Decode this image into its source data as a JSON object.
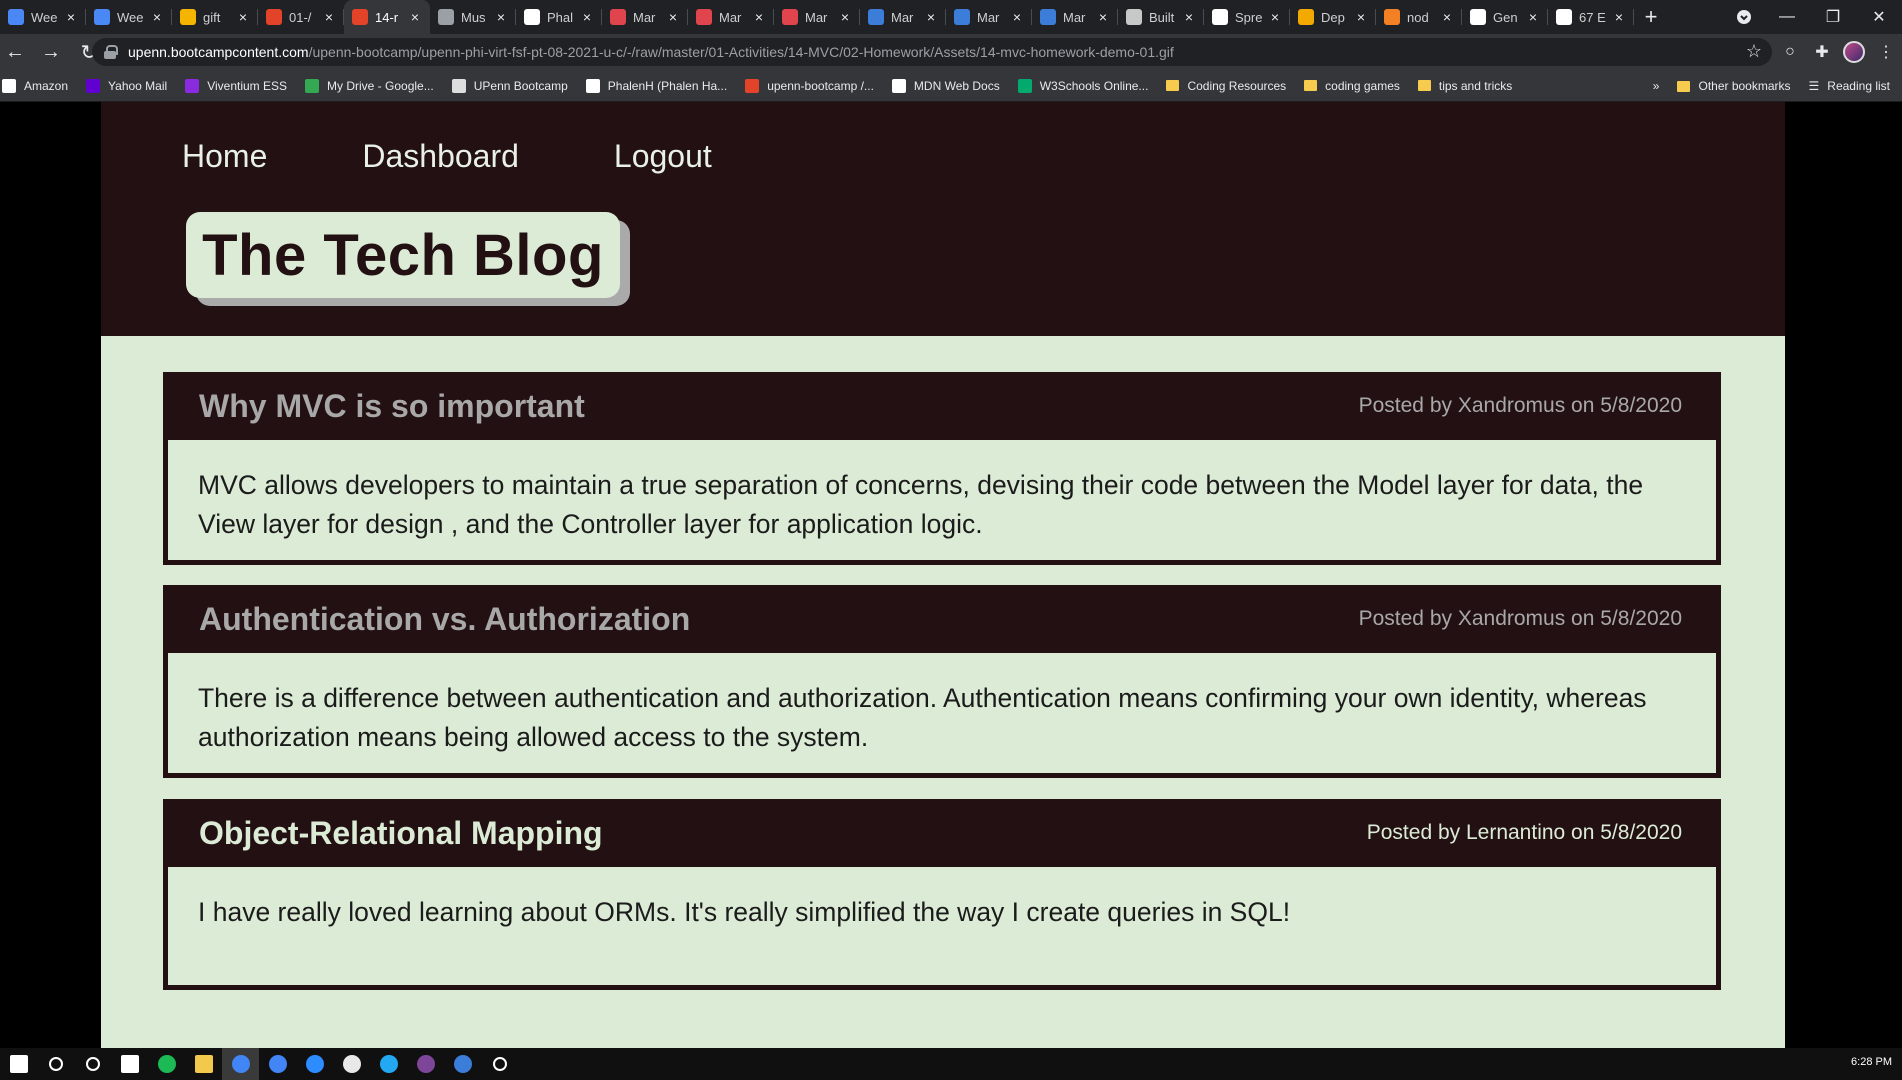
{
  "browser": {
    "tabs": [
      {
        "title": "Wee",
        "favicon_color": "#4a88f5",
        "favicon": "docs-icon"
      },
      {
        "title": "Wee",
        "favicon_color": "#4a88f5",
        "favicon": "docs-icon"
      },
      {
        "title": "gift",
        "favicon_color": "#f4b400",
        "favicon": "slides-icon"
      },
      {
        "title": "01-/",
        "favicon_color": "#e24329",
        "favicon": "gitlab-icon"
      },
      {
        "title": "14-r",
        "favicon_color": "#e24329",
        "favicon": "gitlab-icon",
        "active": true
      },
      {
        "title": "Mus",
        "favicon_color": "#9aa0a6",
        "favicon": "globe-icon"
      },
      {
        "title": "Phal",
        "favicon_color": "#ffffff",
        "favicon": "github-icon"
      },
      {
        "title": "Mar",
        "favicon_color": "#e0444c",
        "favicon": "mongoose-icon"
      },
      {
        "title": "Mar",
        "favicon_color": "#e0444c",
        "favicon": "mongoose-icon"
      },
      {
        "title": "Mar",
        "favicon_color": "#e0444c",
        "favicon": "mongoose-icon"
      },
      {
        "title": "Mar",
        "favicon_color": "#3b7dd8",
        "favicon": "cube-icon"
      },
      {
        "title": "Mar",
        "favicon_color": "#3b7dd8",
        "favicon": "cube-icon"
      },
      {
        "title": "Mar",
        "favicon_color": "#3b7dd8",
        "favicon": "cube-icon"
      },
      {
        "title": "Built",
        "favicon_color": "#c8c8c8",
        "favicon": "link-icon"
      },
      {
        "title": "Spre",
        "favicon_color": "#ffffff",
        "favicon": "bootcamp-icon"
      },
      {
        "title": "Dep",
        "favicon_color": "#f2a900",
        "favicon": "fs-icon"
      },
      {
        "title": "nod",
        "favicon_color": "#f48024",
        "favicon": "stackoverflow-icon"
      },
      {
        "title": "Gen",
        "favicon_color": "#ffffff",
        "favicon": "bootcamp-icon"
      },
      {
        "title": "67 E",
        "favicon_color": "#ffffff",
        "favicon": "f-icon"
      }
    ],
    "new_tab": "+",
    "url_host": "upenn.bootcampcontent.com",
    "url_path": "/upenn-bootcamp/upenn-phi-virt-fsf-pt-08-2021-u-c/-/raw/master/01-Activities/14-MVC/02-Homework/Assets/14-mvc-homework-demo-01.gif",
    "bookmarks": [
      {
        "label": "Amazon",
        "icon": "amazon-icon",
        "color": "#ffffff"
      },
      {
        "label": "Yahoo Mail",
        "icon": "yahoo-mail-icon",
        "color": "#6001d2"
      },
      {
        "label": "Viventium ESS",
        "icon": "viventium-icon",
        "color": "#8a2be2"
      },
      {
        "label": "My Drive - Google...",
        "icon": "google-drive-icon",
        "color": "#34a853"
      },
      {
        "label": "UPenn Bootcamp",
        "icon": "globe-icon",
        "color": "#dddddd"
      },
      {
        "label": "PhalenH (Phalen Ha...",
        "icon": "github-icon",
        "color": "#ffffff"
      },
      {
        "label": "upenn-bootcamp /...",
        "icon": "gitlab-icon",
        "color": "#e24329"
      },
      {
        "label": "MDN Web Docs",
        "icon": "mdn-icon",
        "color": "#ffffff"
      },
      {
        "label": "W3Schools Online...",
        "icon": "w3schools-icon",
        "color": "#04aa6d"
      },
      {
        "label": "Coding Resources",
        "icon": "folder-icon",
        "color": "#f7cb4d"
      },
      {
        "label": "coding games",
        "icon": "folder-icon",
        "color": "#f7cb4d"
      },
      {
        "label": "tips and tricks",
        "icon": "folder-icon",
        "color": "#f7cb4d"
      }
    ],
    "bookmarks_overflow": "»",
    "other_bookmarks": "Other bookmarks",
    "reading_list": "Reading list"
  },
  "site": {
    "nav": [
      "Home",
      "Dashboard",
      "Logout"
    ],
    "logo": "The Tech Blog",
    "posts": [
      {
        "title": "Why MVC is so important",
        "meta": "Posted by Xandromus on 5/8/2020",
        "body": "MVC allows developers to maintain a true separation of concerns, devising their code between the Model layer for data, the View layer for design , and the Controller layer for application logic."
      },
      {
        "title": "Authentication vs. Authorization",
        "meta": "Posted by Xandromus on 5/8/2020",
        "body": "There is a difference between authentication and authorization. Authentication means confirming your own identity, whereas authorization means being allowed access to the system."
      },
      {
        "title": "Object-Relational Mapping",
        "meta": "Posted by Lernantino  on 5/8/2020",
        "body": "I have really loved learning about ORMs. It's really simplified the way I create queries in SQL!"
      }
    ]
  },
  "colors": {
    "header_bg": "#221013",
    "page_bg": "#dcebd6",
    "muted_text": "#a9a8a8"
  },
  "taskbar": {
    "clock": "6:28 PM",
    "apps": [
      "start-icon",
      "search-icon",
      "cortana-icon",
      "task-view-icon",
      "spotify-icon",
      "file-explorer-icon",
      "chrome-icon",
      "chrome-icon",
      "zoom-icon",
      "slack-icon",
      "vscode-icon",
      "tor-icon",
      "terminal-icon",
      "settings-icon"
    ]
  }
}
